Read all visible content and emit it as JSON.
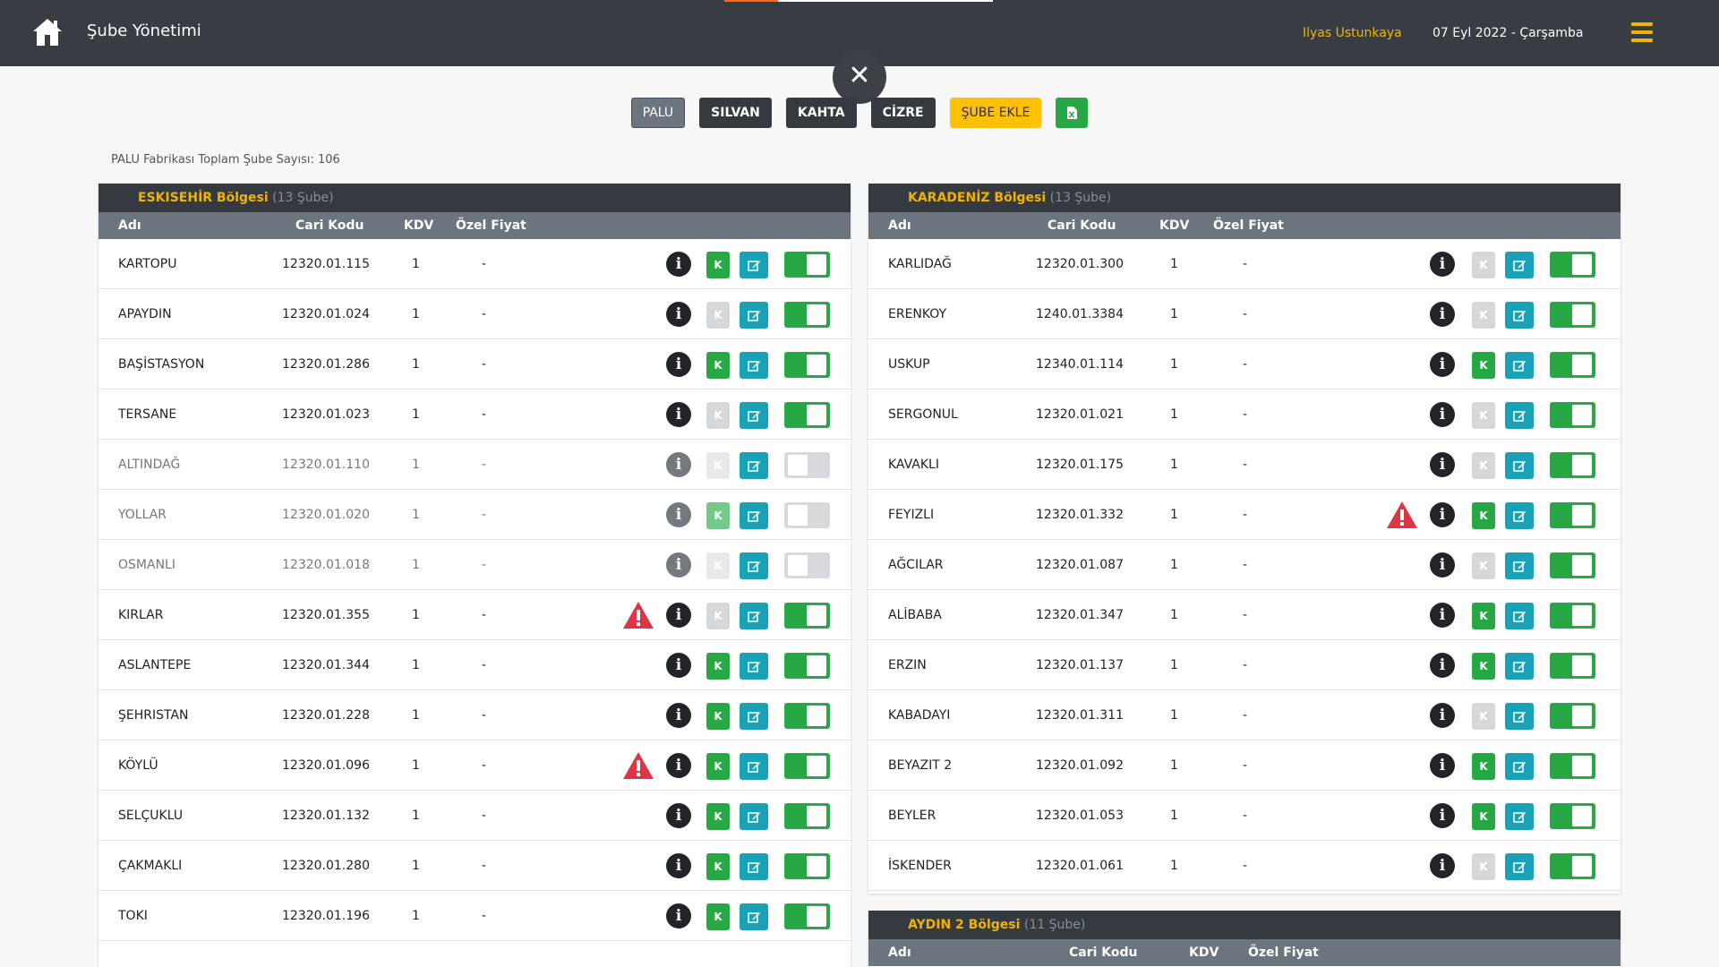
{
  "header": {
    "title": "Şube Yönetimi",
    "user": "Ilyas Ustunkaya",
    "date": "07 Eyl 2022 - Çarşamba"
  },
  "factories": [
    {
      "label": "PALU",
      "active": true
    },
    {
      "label": "SILVAN",
      "active": false
    },
    {
      "label": "KAHTA",
      "active": false
    },
    {
      "label": "CİZRE",
      "active": false
    }
  ],
  "add_branch_label": "ŞUBE EKLE",
  "total_text": "PALU Fabrikası Toplam Şube Sayısı: 106",
  "columns": {
    "name": "Adı",
    "code": "Cari Kodu",
    "kdv": "KDV",
    "price": "Özel Fiyat"
  },
  "regions": [
    {
      "name": "ESKISEHİR Bölgesi",
      "count": "(13 Şube)",
      "rows": [
        {
          "name": "KARTOPU",
          "code": "12320.01.115",
          "kdv": "1",
          "price": "-",
          "k": true,
          "active": true,
          "warning": false
        },
        {
          "name": "APAYDIN",
          "code": "12320.01.024",
          "kdv": "1",
          "price": "-",
          "k": false,
          "active": true,
          "warning": false
        },
        {
          "name": "BAŞİSTASYON",
          "code": "12320.01.286",
          "kdv": "1",
          "price": "-",
          "k": true,
          "active": true,
          "warning": false
        },
        {
          "name": "TERSANE",
          "code": "12320.01.023",
          "kdv": "1",
          "price": "-",
          "k": false,
          "active": true,
          "warning": false
        },
        {
          "name": "ALTINDAĞ",
          "code": "12320.01.110",
          "kdv": "1",
          "price": "-",
          "k": false,
          "active": false,
          "warning": false
        },
        {
          "name": "YOLLAR",
          "code": "12320.01.020",
          "kdv": "1",
          "price": "-",
          "k": true,
          "active": false,
          "warning": false
        },
        {
          "name": "OSMANLI",
          "code": "12320.01.018",
          "kdv": "1",
          "price": "-",
          "k": false,
          "active": false,
          "warning": false
        },
        {
          "name": "KIRLAR",
          "code": "12320.01.355",
          "kdv": "1",
          "price": "-",
          "k": false,
          "active": true,
          "warning": true
        },
        {
          "name": "ASLANTEPE",
          "code": "12320.01.344",
          "kdv": "1",
          "price": "-",
          "k": true,
          "active": true,
          "warning": false
        },
        {
          "name": "ŞEHRISTAN",
          "code": "12320.01.228",
          "kdv": "1",
          "price": "-",
          "k": true,
          "active": true,
          "warning": false
        },
        {
          "name": "KÖYLÜ",
          "code": "12320.01.096",
          "kdv": "1",
          "price": "-",
          "k": true,
          "active": true,
          "warning": true
        },
        {
          "name": "SELÇUKLU",
          "code": "12320.01.132",
          "kdv": "1",
          "price": "-",
          "k": true,
          "active": true,
          "warning": false
        },
        {
          "name": "ÇAKMAKLI",
          "code": "12320.01.280",
          "kdv": "1",
          "price": "-",
          "k": true,
          "active": true,
          "warning": false
        },
        {
          "name": "TOKI",
          "code": "12320.01.196",
          "kdv": "1",
          "price": "-",
          "k": true,
          "active": true,
          "warning": false
        }
      ]
    },
    {
      "name": "KARADENİZ Bölgesi",
      "count": "(13 Şube)",
      "rows": [
        {
          "name": "KARLIDAĞ",
          "code": "12320.01.300",
          "kdv": "1",
          "price": "-",
          "k": false,
          "active": true,
          "warning": false
        },
        {
          "name": "ERENKOY",
          "code": "1240.01.3384",
          "kdv": "1",
          "price": "-",
          "k": false,
          "active": true,
          "warning": false
        },
        {
          "name": "USKUP",
          "code": "12340.01.114",
          "kdv": "1",
          "price": "-",
          "k": true,
          "active": true,
          "warning": false
        },
        {
          "name": "SERGONUL",
          "code": "12320.01.021",
          "kdv": "1",
          "price": "-",
          "k": false,
          "active": true,
          "warning": false
        },
        {
          "name": "KAVAKLI",
          "code": "12320.01.175",
          "kdv": "1",
          "price": "-",
          "k": false,
          "active": true,
          "warning": false
        },
        {
          "name": "FEYIZLI",
          "code": "12320.01.332",
          "kdv": "1",
          "price": "-",
          "k": true,
          "active": true,
          "warning": true
        },
        {
          "name": "AĞCILAR",
          "code": "12320.01.087",
          "kdv": "1",
          "price": "-",
          "k": false,
          "active": true,
          "warning": false
        },
        {
          "name": "ALİBABA",
          "code": "12320.01.347",
          "kdv": "1",
          "price": "-",
          "k": true,
          "active": true,
          "warning": false
        },
        {
          "name": "ERZIN",
          "code": "12320.01.137",
          "kdv": "1",
          "price": "-",
          "k": true,
          "active": true,
          "warning": false
        },
        {
          "name": "KABADAYI",
          "code": "12320.01.311",
          "kdv": "1",
          "price": "-",
          "k": false,
          "active": true,
          "warning": false
        },
        {
          "name": "BEYAZIT 2",
          "code": "12320.01.092",
          "kdv": "1",
          "price": "-",
          "k": true,
          "active": true,
          "warning": false
        },
        {
          "name": "BEYLER",
          "code": "12320.01.053",
          "kdv": "1",
          "price": "-",
          "k": true,
          "active": true,
          "warning": false
        },
        {
          "name": "İSKENDER",
          "code": "12320.01.061",
          "kdv": "1",
          "price": "-",
          "k": false,
          "active": true,
          "warning": false
        }
      ]
    },
    {
      "name": "AYDIN 2 Bölgesi",
      "count": "(11 Şube)",
      "rows": []
    }
  ]
}
